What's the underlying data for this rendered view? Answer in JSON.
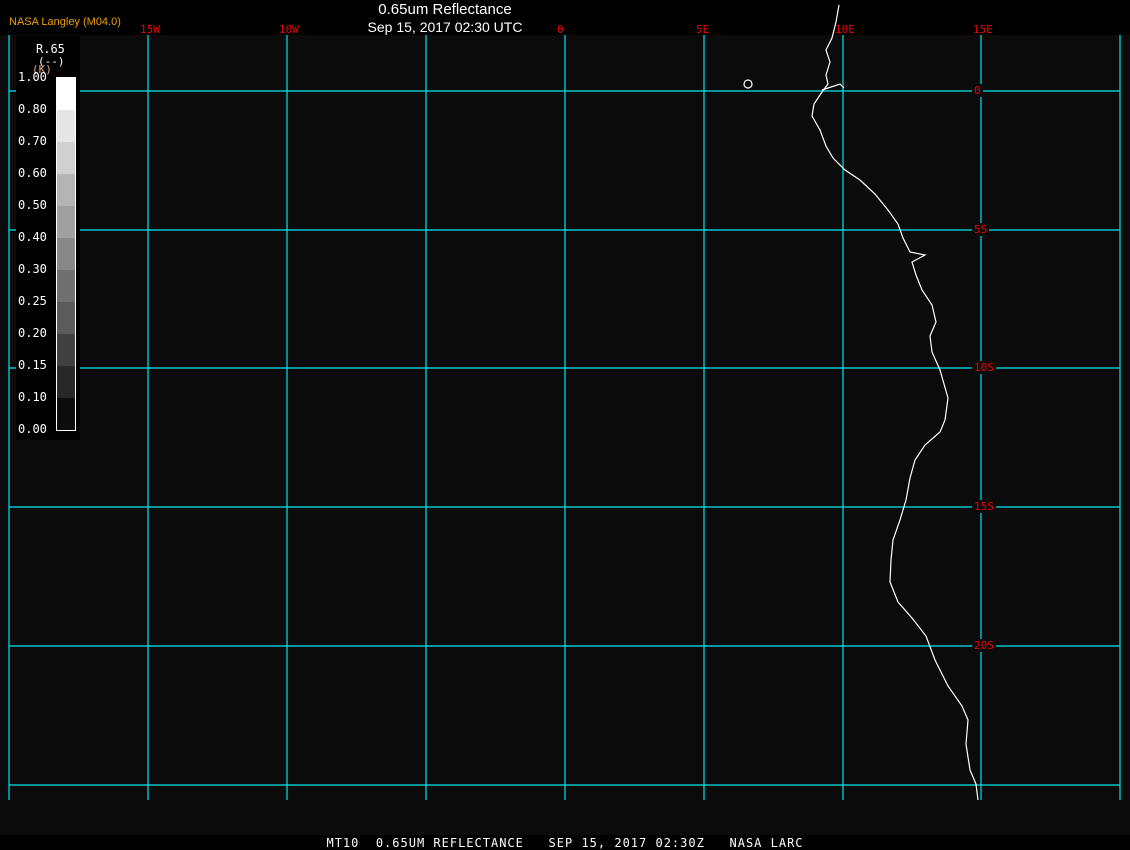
{
  "header": {
    "credit": "NASA Langley (M04.0)",
    "title": "0.65um Reflectance",
    "subtitle": "Sep 15, 2017 02:30 UTC"
  },
  "legend": {
    "variable": "R.65",
    "units": "(--)",
    "units_overlay": "(K)",
    "labels": [
      "1.00",
      "0.80",
      "0.70",
      "0.60",
      "0.50",
      "0.40",
      "0.30",
      "0.25",
      "0.20",
      "0.15",
      "0.10",
      "0.00"
    ],
    "colors": [
      "#ffffff",
      "#e6e6e6",
      "#d0d0d0",
      "#b4b4b4",
      "#a0a0a0",
      "#888888",
      "#707070",
      "#5c5c5c",
      "#404040",
      "#282828",
      "#0c0c0c"
    ]
  },
  "grid": {
    "longitude_labels": [
      "15W",
      "10W",
      "0",
      "5E",
      "10E",
      "15E"
    ],
    "latitude_labels": [
      "0",
      "5S",
      "10S",
      "15S",
      "20S"
    ],
    "grid_color": "#00e5ee",
    "label_color": "#e00000",
    "coastline_color": "#ffffff"
  },
  "footer": "MT10  0.65UM REFLECTANCE   SEP 15, 2017 02:30Z   NASA LARC"
}
